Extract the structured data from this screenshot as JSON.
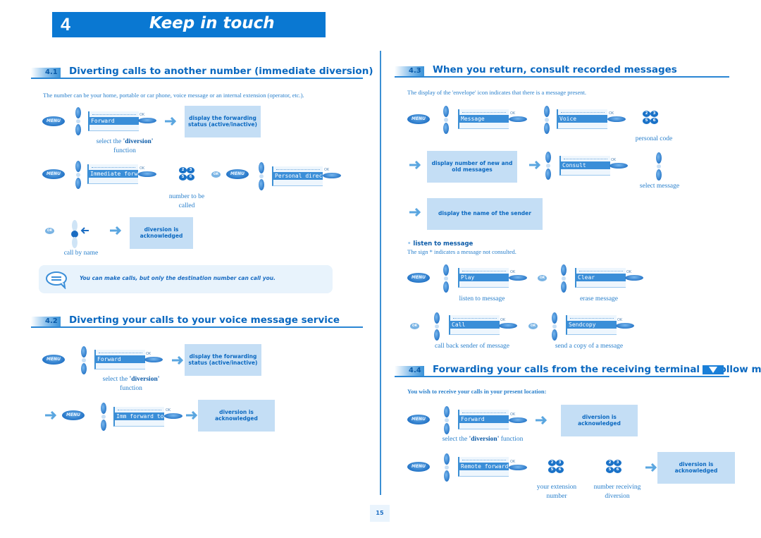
{
  "chapter": {
    "number": "4",
    "title": "Keep in touch"
  },
  "page_number": "15",
  "colors": {
    "accent": "#0a78d2",
    "box_bg": "#c4def5",
    "text": "#2a80cc"
  },
  "icons": {
    "menu": "MENU",
    "ok": "OK",
    "or": "OR",
    "keypad_keys": [
      "2",
      "3",
      "5",
      "6"
    ]
  },
  "sections": {
    "s41": {
      "number": "4.1",
      "title": "Diverting calls to another number (immediate diversion)",
      "intro": "The number can be your home, portable or car phone, voice message or an internal extension (operator, etc.).",
      "step1": {
        "screen": "Forward",
        "box": "display the forwarding status (active/inactive)",
        "caption_pre": "select the ",
        "caption_bold": "'diversion'",
        "caption_post": "function"
      },
      "step2": {
        "screen": "Immediate forward",
        "caption_line1": "number to be",
        "caption_line2": "called",
        "screen2": "Personal directory"
      },
      "step3": {
        "caption": "call by name",
        "box": "diversion is acknowledged"
      },
      "note": "You can make calls, but only the destination number can call you."
    },
    "s42": {
      "number": "4.2",
      "title": "Diverting your calls to your voice message service",
      "step1": {
        "screen": "Forward",
        "box": "display the forwarding status (active/inactive)",
        "caption_pre": "select the ",
        "caption_bold": "'diversion'",
        "caption_post": "function"
      },
      "step2": {
        "screen": "Imm forward to V",
        "box": "diversion is acknowledged"
      }
    },
    "s43": {
      "number": "4.3",
      "title": "When you return, consult recorded messages",
      "intro": "The display of the 'envelope' icon indicates that there is a message present.",
      "step1": {
        "screen1": "Message",
        "screen2": "Voice",
        "caption": "personal code"
      },
      "step2": {
        "box": "display number of new and old messages",
        "screen": "Consult",
        "caption": "select message"
      },
      "step3": {
        "box": "display the name of the sender"
      },
      "listen_heading": "listen to message",
      "listen_note": "The sign * indicates a message not consulted.",
      "actions": [
        {
          "screen": "Play",
          "caption": "listen to message"
        },
        {
          "screen": "Clear",
          "caption": "erase message"
        },
        {
          "screen": "Call",
          "caption": "call back sender of message"
        },
        {
          "screen": "Sendcopy",
          "caption": "send a copy of a message"
        }
      ]
    },
    "s44": {
      "number": "4.4",
      "title": "Forwarding your calls from the receiving terminal (“Follow me”)",
      "intro": "You wish to receive your calls in your present location:",
      "step1": {
        "screen": "Forward",
        "box": "diversion is acknowledged",
        "caption_pre": "select the ",
        "caption_bold": "'diversion'",
        "caption_post": " function"
      },
      "step2": {
        "screen": "Remote forward",
        "caption1_line1": "your extension",
        "caption1_line2": "number",
        "caption2_line1": "number receiving",
        "caption2_line2": "diversion",
        "box": "diversion is acknowledged"
      }
    }
  }
}
